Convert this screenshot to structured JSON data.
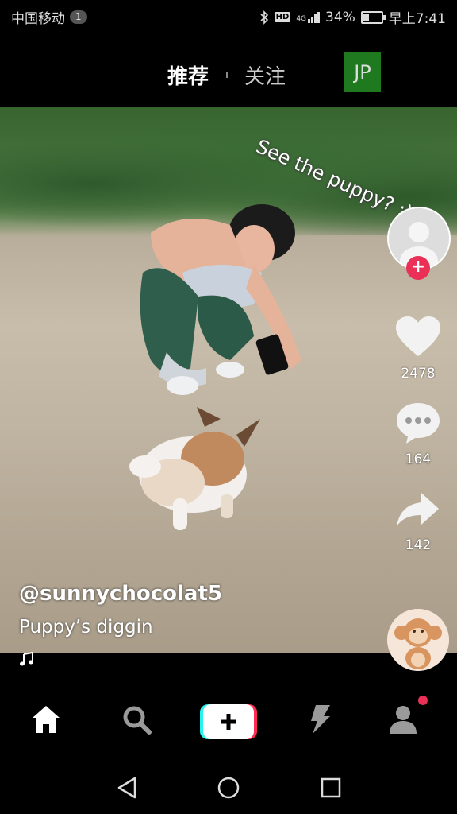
{
  "statusbar": {
    "carrier": "中国移动",
    "sim_badge": "1",
    "hd": "HD",
    "network": "4G",
    "battery_percent": "34%",
    "battery_level": 0.34,
    "time": "早上7:41"
  },
  "topnav": {
    "tab_recommend": "推荐",
    "tab_following": "关注",
    "jp_badge": "JP"
  },
  "video": {
    "overlay_caption": "See the puppy? :)"
  },
  "actions": {
    "likes": "2478",
    "comments": "164",
    "shares": "142"
  },
  "post": {
    "username": "@sunnychocolat5",
    "description": "Puppy’s diggin"
  },
  "colors": {
    "accent": "#ea3057",
    "jp_badge": "#1f7a1f"
  },
  "icons": {
    "home": "home-icon",
    "search": "search-icon",
    "create": "create-plus-icon",
    "inbox": "lightning-icon",
    "profile": "profile-icon"
  }
}
